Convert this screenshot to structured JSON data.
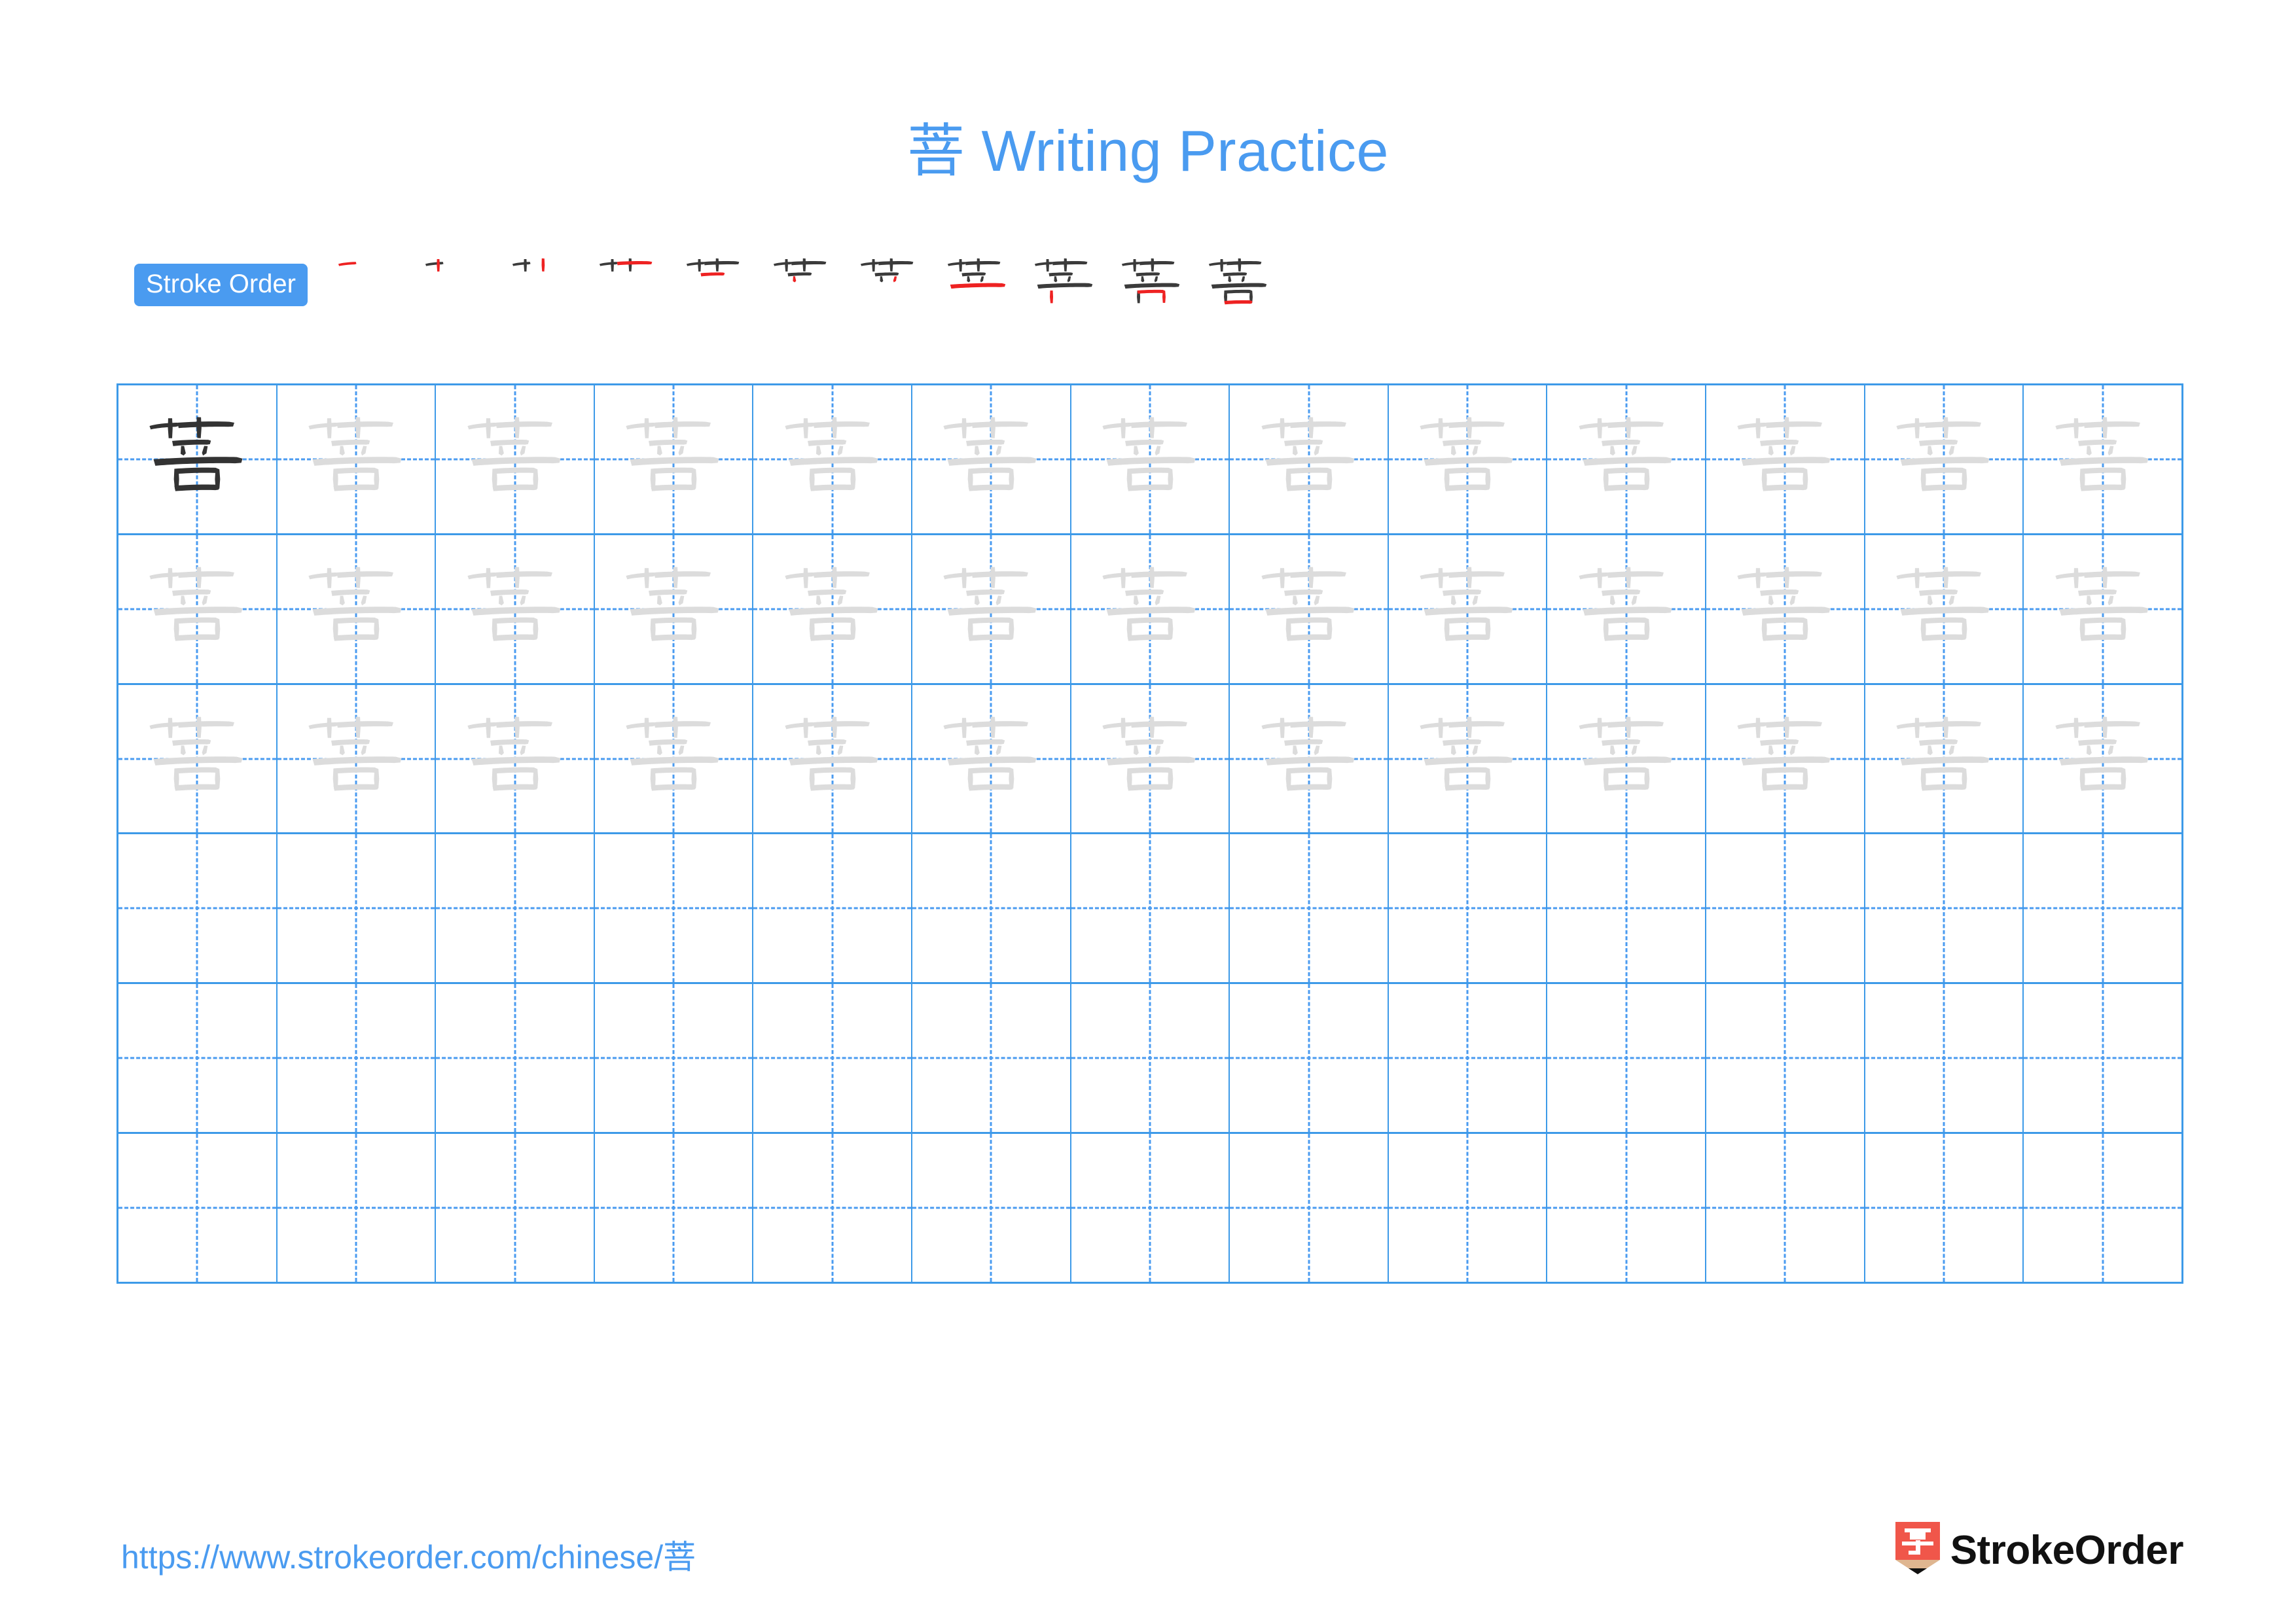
{
  "page": {
    "character": "菩",
    "title": "菩 Writing Practice",
    "background_color": "#ffffff"
  },
  "colors": {
    "accent_blue": "#4a9bf0",
    "grid_blue": "#3d9ae8",
    "stroke_highlight_red": "#ee2222",
    "stroke_existing_dark": "#3b3b3b",
    "trace_gray": "#dcdcdc",
    "glyph_dark": "#333333",
    "logo_red": "#f0564a",
    "logo_wood": "#dfb690",
    "logo_tip": "#111111",
    "logo_text": "#111111"
  },
  "stroke_order": {
    "badge_label": "Stroke Order",
    "total_strokes": 11,
    "steps": [
      {
        "index": 1,
        "new_stroke": "横 (heng)"
      },
      {
        "index": 2,
        "new_stroke": "竖 (shu)"
      },
      {
        "index": 3,
        "new_stroke": "竖 (shu)"
      },
      {
        "index": 4,
        "new_stroke": "竖 (shu)"
      },
      {
        "index": 5,
        "new_stroke": "横 (heng)"
      },
      {
        "index": 6,
        "new_stroke": "竖 (shu)"
      },
      {
        "index": 7,
        "new_stroke": "撇 (pie)"
      },
      {
        "index": 8,
        "new_stroke": "横 (heng)"
      },
      {
        "index": 9,
        "new_stroke": "竖 (shu)"
      },
      {
        "index": 10,
        "new_stroke": "横折 (hengzhe)"
      },
      {
        "index": 11,
        "new_stroke": "横 (heng)"
      }
    ]
  },
  "practice_grid": {
    "columns": 13,
    "rows": 6,
    "cell_guides": "crosshair-dashed",
    "row_contents": [
      {
        "row": 1,
        "cells": [
          "dark",
          "light",
          "light",
          "light",
          "light",
          "light",
          "light",
          "light",
          "light",
          "light",
          "light",
          "light",
          "light"
        ]
      },
      {
        "row": 2,
        "cells": [
          "light",
          "light",
          "light",
          "light",
          "light",
          "light",
          "light",
          "light",
          "light",
          "light",
          "light",
          "light",
          "light"
        ]
      },
      {
        "row": 3,
        "cells": [
          "light",
          "light",
          "light",
          "light",
          "light",
          "light",
          "light",
          "light",
          "light",
          "light",
          "light",
          "light",
          "light"
        ]
      },
      {
        "row": 4,
        "cells": [
          "empty",
          "empty",
          "empty",
          "empty",
          "empty",
          "empty",
          "empty",
          "empty",
          "empty",
          "empty",
          "empty",
          "empty",
          "empty"
        ]
      },
      {
        "row": 5,
        "cells": [
          "empty",
          "empty",
          "empty",
          "empty",
          "empty",
          "empty",
          "empty",
          "empty",
          "empty",
          "empty",
          "empty",
          "empty",
          "empty"
        ]
      },
      {
        "row": 6,
        "cells": [
          "empty",
          "empty",
          "empty",
          "empty",
          "empty",
          "empty",
          "empty",
          "empty",
          "empty",
          "empty",
          "empty",
          "empty",
          "empty"
        ]
      }
    ]
  },
  "footer": {
    "url": "https://www.strokeorder.com/chinese/菩",
    "logo_text": "StrokeOrder",
    "logo_mark_character": "字"
  }
}
